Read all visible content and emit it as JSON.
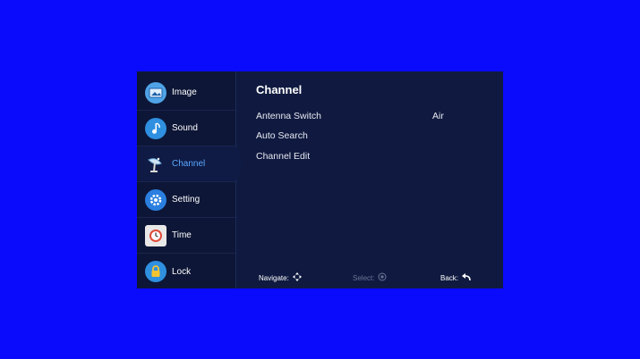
{
  "sidebar": {
    "items": [
      {
        "label": "Image",
        "icon": "image-icon",
        "color": "#4fa3e6"
      },
      {
        "label": "Sound",
        "icon": "music-note-icon",
        "color": "#2f8fe0"
      },
      {
        "label": "Channel",
        "icon": "satellite-dish-icon",
        "color": "#6aa7d6"
      },
      {
        "label": "Setting",
        "icon": "gear-icon",
        "color": "#2a7fe0"
      },
      {
        "label": "Time",
        "icon": "clock-icon",
        "color": "#e04a3a"
      },
      {
        "label": "Lock",
        "icon": "lock-icon",
        "color": "#2f8fe0"
      }
    ],
    "active_index": 2
  },
  "main": {
    "title": "Channel",
    "rows": [
      {
        "label": "Antenna Switch",
        "value": "Air"
      },
      {
        "label": "Auto Search",
        "value": ""
      },
      {
        "label": "Channel Edit",
        "value": ""
      }
    ]
  },
  "footer": {
    "navigate_label": "Navigate:",
    "select_label": "Select:",
    "back_label": "Back:"
  },
  "colors": {
    "background": "#0a0afd",
    "panel": "#101a40",
    "active_text": "#5ba7ff"
  }
}
